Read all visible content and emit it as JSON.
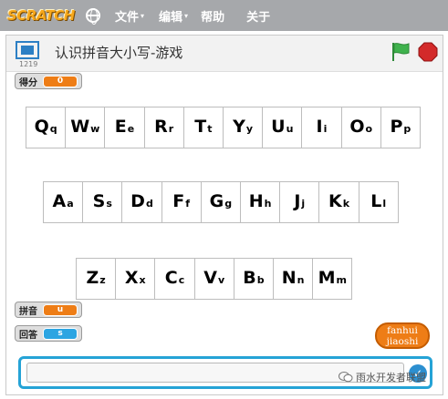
{
  "menubar": {
    "logo": "SCRATCH",
    "items": [
      {
        "label": "文件",
        "has_caret": true
      },
      {
        "label": "编辑",
        "has_caret": true
      },
      {
        "label": "帮助",
        "has_caret": false
      },
      {
        "label": "关于",
        "has_caret": false
      }
    ],
    "globe_icon": "globe-icon",
    "caret": "▾"
  },
  "stage": {
    "version": "1219",
    "title": "认识拼音大小写-游戏",
    "flag_color": "#3fb24d",
    "stop_color": "#d32a2a"
  },
  "monitors": {
    "score": {
      "label": "得分",
      "value": "0"
    },
    "pinyin": {
      "label": "拼音",
      "value": "u"
    },
    "answer": {
      "label": "回答",
      "value": "s"
    }
  },
  "keyboard_rows": [
    [
      [
        "Q",
        "q"
      ],
      [
        "W",
        "w"
      ],
      [
        "E",
        "e"
      ],
      [
        "R",
        "r"
      ],
      [
        "T",
        "t"
      ],
      [
        "Y",
        "y"
      ],
      [
        "U",
        "u"
      ],
      [
        "I",
        "i"
      ],
      [
        "O",
        "o"
      ],
      [
        "P",
        "p"
      ]
    ],
    [
      [
        "A",
        "a"
      ],
      [
        "S",
        "s"
      ],
      [
        "D",
        "d"
      ],
      [
        "F",
        "f"
      ],
      [
        "G",
        "g"
      ],
      [
        "H",
        "h"
      ],
      [
        "J",
        "j"
      ],
      [
        "K",
        "k"
      ],
      [
        "L",
        "l"
      ]
    ],
    [
      [
        "Z",
        "z"
      ],
      [
        "X",
        "x"
      ],
      [
        "C",
        "c"
      ],
      [
        "V",
        "v"
      ],
      [
        "B",
        "b"
      ],
      [
        "N",
        "n"
      ],
      [
        "M",
        "m"
      ]
    ]
  ],
  "back_button": {
    "line1": "fanhui",
    "line2": "jiaoshi"
  },
  "answer_box": {
    "value": "",
    "check": "✓"
  },
  "watermark": "雨水开发者联盟"
}
